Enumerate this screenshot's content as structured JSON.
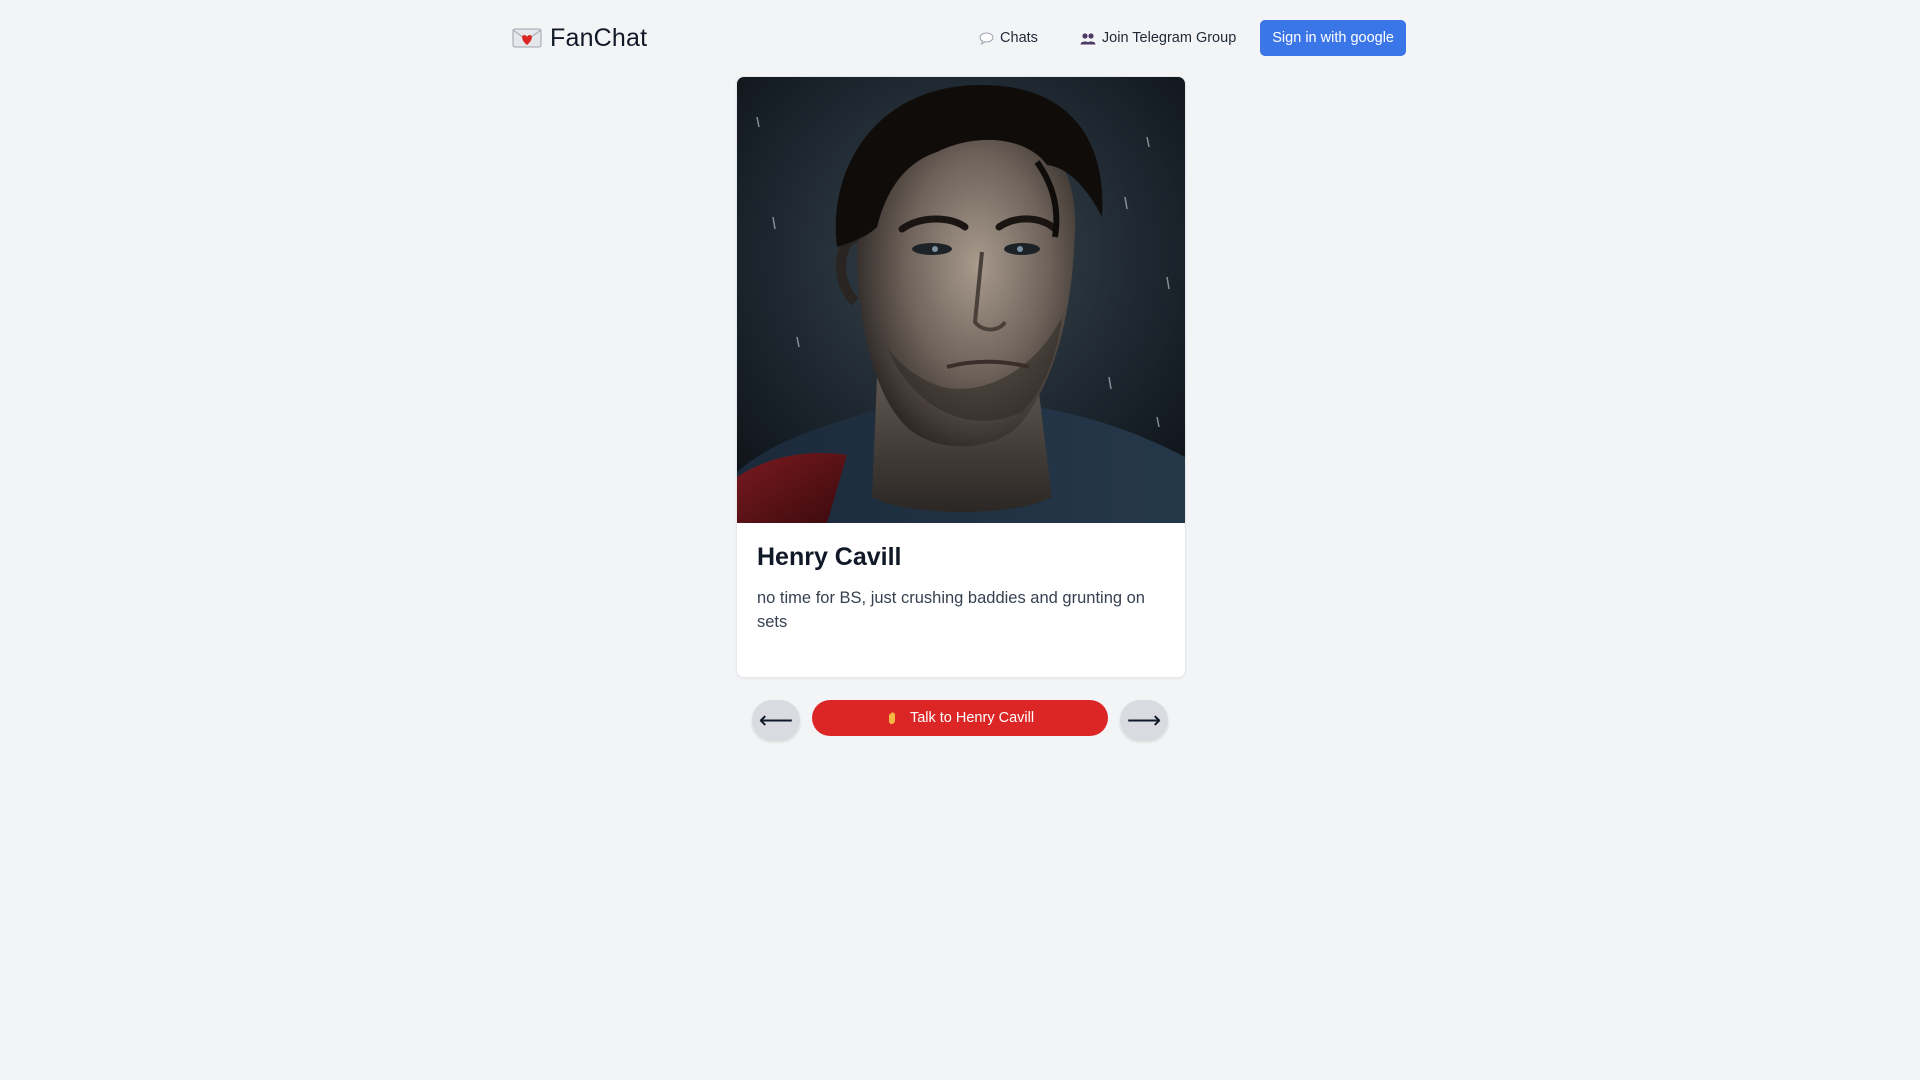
{
  "header": {
    "logo_icon": "love-letter-icon",
    "brand": "FanChat",
    "nav": [
      {
        "icon": "speech-bubble-icon",
        "label": "Chats"
      },
      {
        "icon": "people-icon",
        "label": "Join Telegram Group"
      }
    ],
    "signin_label": "Sign in with google",
    "signin_color": "#3b76e9"
  },
  "card": {
    "image_alt": "Henry Cavill portrait",
    "name": "Henry Cavill",
    "description": "no time for BS, just crushing baddies and grunting on sets"
  },
  "controls": {
    "prev_label": "⟵",
    "next_label": "⟶",
    "talk_icon": "waving-hand-icon",
    "talk_label": "Talk to Henry Cavill",
    "talk_color": "#dc2626"
  }
}
